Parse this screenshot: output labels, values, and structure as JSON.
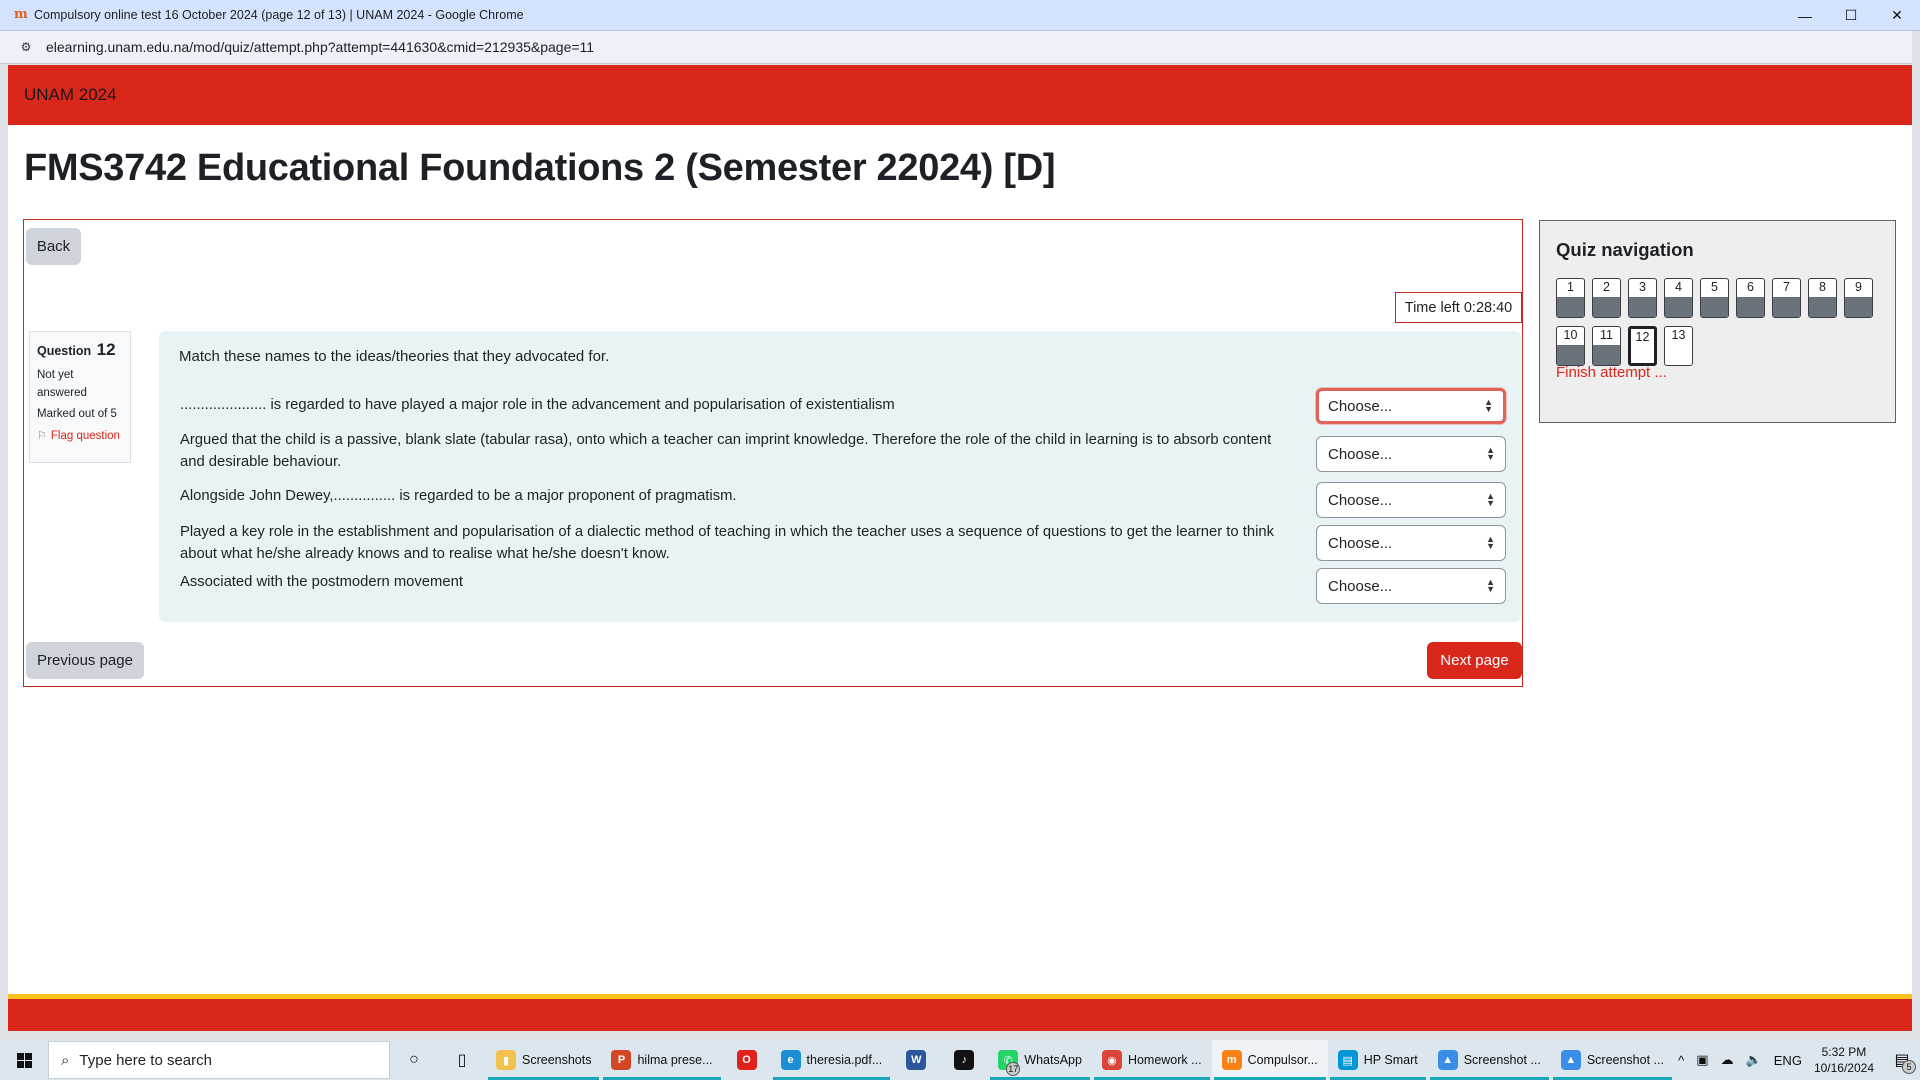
{
  "window": {
    "title": "Compulsory online test 16 October 2024 (page 12 of 13) | UNAM 2024 - Google Chrome",
    "favicon": "moodle-icon",
    "controls": {
      "minimize": "—",
      "maximize": "☐",
      "close": "✕"
    }
  },
  "address_bar": {
    "url": "elearning.unam.edu.na/mod/quiz/attempt.php?attempt=441630&cmid=212935&page=11"
  },
  "navbar": {
    "brand": "UNAM 2024"
  },
  "course": {
    "title": "FMS3742 Educational Foundations 2 (Semester 22024) [D]"
  },
  "quiz": {
    "back_label": "Back",
    "timer": "Time left 0:28:40",
    "question": {
      "label": "Question",
      "number": "12",
      "state": "Not yet answered",
      "grade": "Marked out of 5",
      "flag_label": "Flag question",
      "text": "Match these names to the ideas/theories that they advocated for.",
      "rows": [
        {
          "stem": "..................... is regarded to have played a major role in the advancement and popularisation of existentialism",
          "selected": "Choose..."
        },
        {
          "stem": "Argued that the child is a passive, blank slate (tabular rasa), onto which a teacher can imprint knowledge. Therefore the role of the child in learning is to absorb content and desirable behaviour.",
          "selected": "Choose..."
        },
        {
          "stem": "Alongside John Dewey,............... is regarded to be a major proponent of pragmatism.",
          "selected": "Choose..."
        },
        {
          "stem": "Played a key role in the establishment and popularisation of a dialectic method of teaching in which the teacher uses a sequence of questions to get the learner to think about what he/she already knows and to realise what he/she doesn't know.",
          "selected": "Choose..."
        },
        {
          "stem": "Associated with the postmodern movement",
          "selected": "Choose..."
        }
      ]
    },
    "prev_label": "Previous page",
    "next_label": "Next page"
  },
  "quiz_navigation": {
    "title": "Quiz navigation",
    "questions": [
      {
        "label": "1",
        "answered": true,
        "current": false
      },
      {
        "label": "2",
        "answered": true,
        "current": false
      },
      {
        "label": "3",
        "answered": true,
        "current": false
      },
      {
        "label": "4",
        "answered": true,
        "current": false
      },
      {
        "label": "5",
        "answered": true,
        "current": false
      },
      {
        "label": "6",
        "answered": true,
        "current": false
      },
      {
        "label": "7",
        "answered": true,
        "current": false
      },
      {
        "label": "8",
        "answered": true,
        "current": false
      },
      {
        "label": "9",
        "answered": true,
        "current": false
      },
      {
        "label": "10",
        "answered": true,
        "current": false
      },
      {
        "label": "11",
        "answered": true,
        "current": false
      },
      {
        "label": "12",
        "answered": false,
        "current": true
      },
      {
        "label": "13",
        "answered": false,
        "current": false
      }
    ],
    "finish_label": "Finish attempt ..."
  },
  "colors": {
    "brand_red": "#d9271c",
    "footer_yellow": "#fdc11a",
    "question_bg": "#e7f3f5",
    "answered_fill": "#6a737b"
  },
  "taskbar": {
    "search_placeholder": "Type here to search",
    "apps": [
      {
        "name": "Screenshots",
        "icon": "folder-icon",
        "color": "#f2c14e",
        "glyph": "▮",
        "open": true
      },
      {
        "name": "hilma prese...",
        "icon": "powerpoint-icon",
        "color": "#d24726",
        "glyph": "P",
        "open": true
      },
      {
        "name": "",
        "icon": "opera-icon",
        "color": "#e0201b",
        "glyph": "O",
        "open": false
      },
      {
        "name": "theresia.pdf...",
        "icon": "edge-icon",
        "color": "#1a8fd6",
        "glyph": "e",
        "open": true
      },
      {
        "name": "",
        "icon": "word-icon",
        "color": "#2b579a",
        "glyph": "W",
        "open": false
      },
      {
        "name": "",
        "icon": "tiktok-icon",
        "color": "#111111",
        "glyph": "♪",
        "open": false
      },
      {
        "name": "WhatsApp",
        "icon": "whatsapp-icon",
        "color": "#25d366",
        "glyph": "✆",
        "open": true,
        "badge": "17"
      },
      {
        "name": "Homework ...",
        "icon": "chrome-icon",
        "color": "#db4437",
        "glyph": "◉",
        "open": true
      },
      {
        "name": "Compulsor...",
        "icon": "moodle-icon",
        "color": "#f98012",
        "glyph": "m",
        "open": true,
        "active": true
      },
      {
        "name": "HP Smart",
        "icon": "hp-smart-icon",
        "color": "#0096d6",
        "glyph": "▤",
        "open": true
      },
      {
        "name": "Screenshot ...",
        "icon": "photos-icon",
        "color": "#3a8ee6",
        "glyph": "▲",
        "open": true
      },
      {
        "name": "Screenshot ...",
        "icon": "photos-icon",
        "color": "#3a8ee6",
        "glyph": "▲",
        "open": true
      }
    ],
    "tray": {
      "language": "ENG",
      "time": "5:32 PM",
      "date": "10/16/2024",
      "notification_count": "5"
    }
  }
}
